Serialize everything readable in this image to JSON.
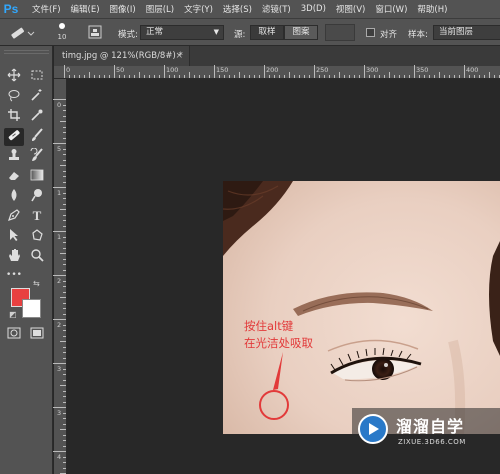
{
  "app": {
    "logo": "Ps"
  },
  "menu": [
    "文件(F)",
    "编辑(E)",
    "图像(I)",
    "图层(L)",
    "文字(Y)",
    "选择(S)",
    "滤镜(T)",
    "3D(D)",
    "视图(V)",
    "窗口(W)",
    "帮助(H)"
  ],
  "options": {
    "brush_size": "10",
    "mode_label": "模式:",
    "mode_value": "正常",
    "source_label": "源:",
    "source_sample": "取样",
    "source_pattern": "图案",
    "align_label": "对齐",
    "sample_label": "样本:",
    "sample_value": "当前图层"
  },
  "document": {
    "tab_title": "timg.jpg @ 121%(RGB/8#) *",
    "close": "×"
  },
  "ruler": {
    "h_labels": [
      "0",
      "50",
      "100",
      "150",
      "200",
      "250",
      "300",
      "350",
      "400"
    ],
    "v_labels": [
      "0",
      "5",
      "1",
      "1",
      "2",
      "2",
      "3",
      "3",
      "4"
    ]
  },
  "toolbar": {
    "tools": [
      "move-icon",
      "marquee-icon",
      "lasso-icon",
      "magic-wand-icon",
      "crop-icon",
      "eyedropper-icon",
      "healing-brush-icon",
      "brush-icon",
      "clone-stamp-icon",
      "history-brush-icon",
      "eraser-icon",
      "gradient-icon",
      "blur-icon",
      "dodge-icon",
      "pen-icon",
      "type-icon",
      "path-select-icon",
      "shape-icon",
      "hand-icon",
      "zoom-icon",
      "more-icon"
    ],
    "more": "•••",
    "foreground_color": "#e84040",
    "background_color": "#ffffff"
  },
  "annotation": {
    "line1": "按住alt键",
    "line2": "在光洁处吸取",
    "color": "#e23a3a"
  },
  "watermark": {
    "title": "溜溜自学",
    "url": "ZIXUE.3D66.COM"
  }
}
